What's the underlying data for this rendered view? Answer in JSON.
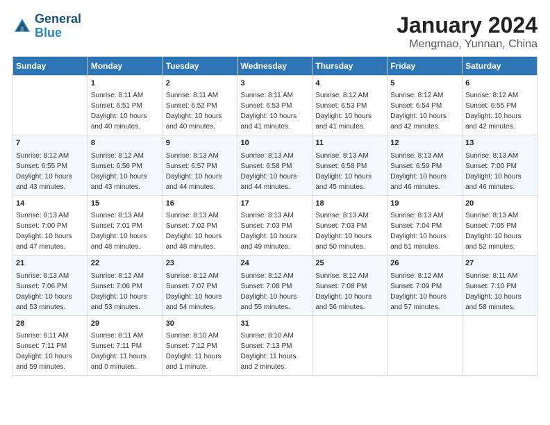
{
  "header": {
    "logo_line1": "General",
    "logo_line2": "Blue",
    "title": "January 2024",
    "subtitle": "Mengmao, Yunnan, China"
  },
  "calendar": {
    "days_of_week": [
      "Sunday",
      "Monday",
      "Tuesday",
      "Wednesday",
      "Thursday",
      "Friday",
      "Saturday"
    ],
    "weeks": [
      [
        {
          "day": "",
          "sunrise": "",
          "sunset": "",
          "daylight": ""
        },
        {
          "day": "1",
          "sunrise": "8:11 AM",
          "sunset": "6:51 PM",
          "daylight": "10 hours and 40 minutes."
        },
        {
          "day": "2",
          "sunrise": "8:11 AM",
          "sunset": "6:52 PM",
          "daylight": "10 hours and 40 minutes."
        },
        {
          "day": "3",
          "sunrise": "8:11 AM",
          "sunset": "6:53 PM",
          "daylight": "10 hours and 41 minutes."
        },
        {
          "day": "4",
          "sunrise": "8:12 AM",
          "sunset": "6:53 PM",
          "daylight": "10 hours and 41 minutes."
        },
        {
          "day": "5",
          "sunrise": "8:12 AM",
          "sunset": "6:54 PM",
          "daylight": "10 hours and 42 minutes."
        },
        {
          "day": "6",
          "sunrise": "8:12 AM",
          "sunset": "6:55 PM",
          "daylight": "10 hours and 42 minutes."
        }
      ],
      [
        {
          "day": "7",
          "sunrise": "8:12 AM",
          "sunset": "6:55 PM",
          "daylight": "10 hours and 43 minutes."
        },
        {
          "day": "8",
          "sunrise": "8:12 AM",
          "sunset": "6:56 PM",
          "daylight": "10 hours and 43 minutes."
        },
        {
          "day": "9",
          "sunrise": "8:13 AM",
          "sunset": "6:57 PM",
          "daylight": "10 hours and 44 minutes."
        },
        {
          "day": "10",
          "sunrise": "8:13 AM",
          "sunset": "6:58 PM",
          "daylight": "10 hours and 44 minutes."
        },
        {
          "day": "11",
          "sunrise": "8:13 AM",
          "sunset": "6:58 PM",
          "daylight": "10 hours and 45 minutes."
        },
        {
          "day": "12",
          "sunrise": "8:13 AM",
          "sunset": "6:59 PM",
          "daylight": "10 hours and 46 minutes."
        },
        {
          "day": "13",
          "sunrise": "8:13 AM",
          "sunset": "7:00 PM",
          "daylight": "10 hours and 46 minutes."
        }
      ],
      [
        {
          "day": "14",
          "sunrise": "8:13 AM",
          "sunset": "7:00 PM",
          "daylight": "10 hours and 47 minutes."
        },
        {
          "day": "15",
          "sunrise": "8:13 AM",
          "sunset": "7:01 PM",
          "daylight": "10 hours and 48 minutes."
        },
        {
          "day": "16",
          "sunrise": "8:13 AM",
          "sunset": "7:02 PM",
          "daylight": "10 hours and 48 minutes."
        },
        {
          "day": "17",
          "sunrise": "8:13 AM",
          "sunset": "7:03 PM",
          "daylight": "10 hours and 49 minutes."
        },
        {
          "day": "18",
          "sunrise": "8:13 AM",
          "sunset": "7:03 PM",
          "daylight": "10 hours and 50 minutes."
        },
        {
          "day": "19",
          "sunrise": "8:13 AM",
          "sunset": "7:04 PM",
          "daylight": "10 hours and 51 minutes."
        },
        {
          "day": "20",
          "sunrise": "8:13 AM",
          "sunset": "7:05 PM",
          "daylight": "10 hours and 52 minutes."
        }
      ],
      [
        {
          "day": "21",
          "sunrise": "8:13 AM",
          "sunset": "7:06 PM",
          "daylight": "10 hours and 53 minutes."
        },
        {
          "day": "22",
          "sunrise": "8:12 AM",
          "sunset": "7:06 PM",
          "daylight": "10 hours and 53 minutes."
        },
        {
          "day": "23",
          "sunrise": "8:12 AM",
          "sunset": "7:07 PM",
          "daylight": "10 hours and 54 minutes."
        },
        {
          "day": "24",
          "sunrise": "8:12 AM",
          "sunset": "7:08 PM",
          "daylight": "10 hours and 55 minutes."
        },
        {
          "day": "25",
          "sunrise": "8:12 AM",
          "sunset": "7:08 PM",
          "daylight": "10 hours and 56 minutes."
        },
        {
          "day": "26",
          "sunrise": "8:12 AM",
          "sunset": "7:09 PM",
          "daylight": "10 hours and 57 minutes."
        },
        {
          "day": "27",
          "sunrise": "8:11 AM",
          "sunset": "7:10 PM",
          "daylight": "10 hours and 58 minutes."
        }
      ],
      [
        {
          "day": "28",
          "sunrise": "8:11 AM",
          "sunset": "7:11 PM",
          "daylight": "10 hours and 59 minutes."
        },
        {
          "day": "29",
          "sunrise": "8:11 AM",
          "sunset": "7:11 PM",
          "daylight": "11 hours and 0 minutes."
        },
        {
          "day": "30",
          "sunrise": "8:10 AM",
          "sunset": "7:12 PM",
          "daylight": "11 hours and 1 minute."
        },
        {
          "day": "31",
          "sunrise": "8:10 AM",
          "sunset": "7:13 PM",
          "daylight": "11 hours and 2 minutes."
        },
        {
          "day": "",
          "sunrise": "",
          "sunset": "",
          "daylight": ""
        },
        {
          "day": "",
          "sunrise": "",
          "sunset": "",
          "daylight": ""
        },
        {
          "day": "",
          "sunrise": "",
          "sunset": "",
          "daylight": ""
        }
      ]
    ],
    "labels": {
      "sunrise": "Sunrise:",
      "sunset": "Sunset:",
      "daylight": "Daylight:"
    }
  }
}
